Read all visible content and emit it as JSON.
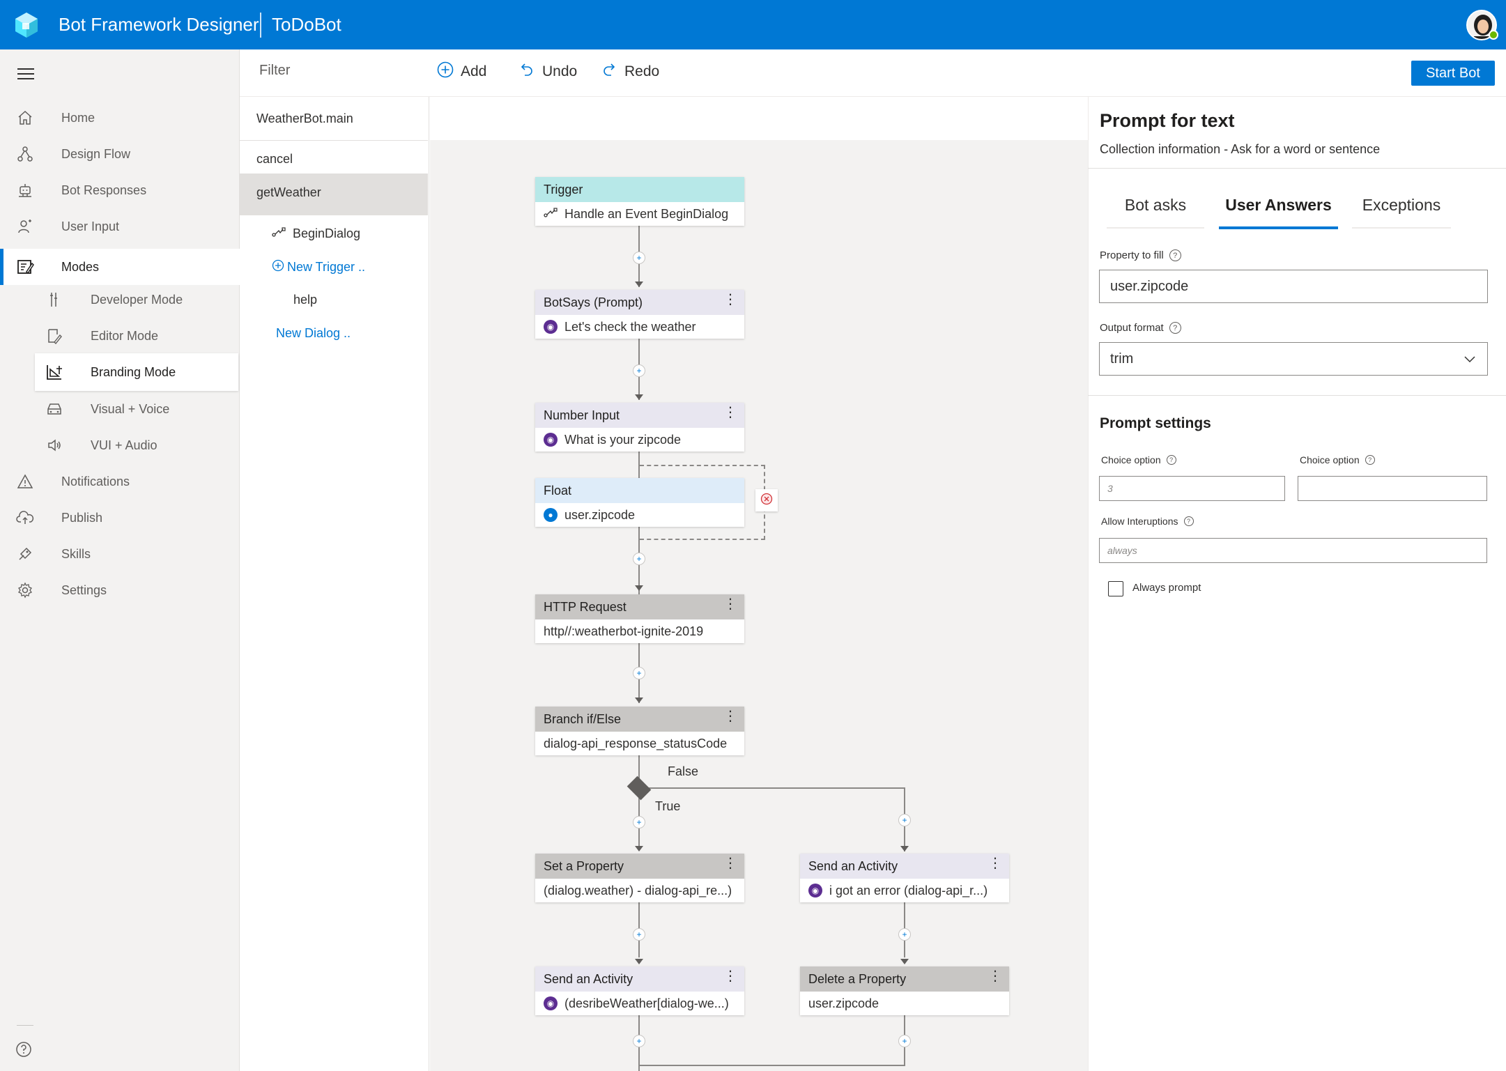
{
  "header": {
    "app_title": "Bot Framework Designer",
    "bot_name": "ToDoBot",
    "brand_color": "#0078d4"
  },
  "nav": {
    "items": [
      {
        "label": "Home",
        "icon": "home-icon"
      },
      {
        "label": "Design Flow",
        "icon": "flow-icon"
      },
      {
        "label": "Bot Responses",
        "icon": "bot-icon"
      },
      {
        "label": "User Input",
        "icon": "user-input-icon"
      },
      {
        "label": "Modes",
        "icon": "modes-icon"
      },
      {
        "label": "Developer Mode",
        "icon": "developer-icon"
      },
      {
        "label": "Editor Mode",
        "icon": "editor-icon"
      },
      {
        "label": "Branding Mode",
        "icon": "branding-icon"
      },
      {
        "label": "Visual + Voice",
        "icon": "car-icon"
      },
      {
        "label": "VUI + Audio",
        "icon": "speaker-icon"
      },
      {
        "label": "Notifications",
        "icon": "warning-icon"
      },
      {
        "label": "Publish",
        "icon": "cloud-upload-icon"
      },
      {
        "label": "Skills",
        "icon": "skills-icon"
      },
      {
        "label": "Settings",
        "icon": "gear-icon"
      }
    ],
    "active_section": "Modes",
    "active_subitem": "Branding Mode"
  },
  "toolbar": {
    "filter_placeholder": "Filter",
    "add_label": "Add",
    "undo_label": "Undo",
    "redo_label": "Redo",
    "start_bot_label": "Start Bot"
  },
  "dialogs": {
    "main": "WeatherBot.main",
    "items": [
      "cancel",
      "getWeather"
    ],
    "selected": "getWeather",
    "triggers": [
      "BeginDialog"
    ],
    "new_trigger": "New Trigger ..",
    "help": "help",
    "new_dialog": "New Dialog .."
  },
  "flow": {
    "trigger": {
      "title": "Trigger",
      "body": "Handle an Event BeginDialog"
    },
    "botsays": {
      "title": "BotSays (Prompt)",
      "body": "Let's check the weather"
    },
    "number_input": {
      "title": "Number Input",
      "body": "What is your zipcode"
    },
    "float": {
      "title": "Float",
      "body": "user.zipcode"
    },
    "http": {
      "title": "HTTP Request",
      "body": "http//:weatherbot-ignite-2019"
    },
    "branch": {
      "title": "Branch if/Else",
      "body": "dialog-api_response_statusCode"
    },
    "false_label": "False",
    "true_label": "True",
    "set_property": {
      "title": "Set a Property",
      "body": "(dialog.weather) - dialog-api_re...)"
    },
    "send_activity_err": {
      "title": "Send an Activity",
      "body": "i got an error (dialog-api_r...)"
    },
    "send_activity": {
      "title": "Send an Activity",
      "body": "(desribeWeather[dialog-we...)"
    },
    "delete_property": {
      "title": "Delete a Property",
      "body": "user.zipcode"
    }
  },
  "panel": {
    "title": "Prompt for text",
    "subtitle": "Collection information - Ask for a word or sentence",
    "tabs": [
      "Bot asks",
      "User Answers",
      "Exceptions"
    ],
    "active_tab": "User Answers",
    "property_label": "Property to fill",
    "property_value": "user.zipcode",
    "output_label": "Output format",
    "output_value": "trim",
    "settings_title": "Prompt settings",
    "choice_label_1": "Choice option",
    "choice_value_1": "3",
    "choice_label_2": "Choice option",
    "choice_value_2": "",
    "interrupt_label": "Allow Interuptions",
    "interrupt_placeholder": "always",
    "always_prompt_label": "Always prompt"
  }
}
